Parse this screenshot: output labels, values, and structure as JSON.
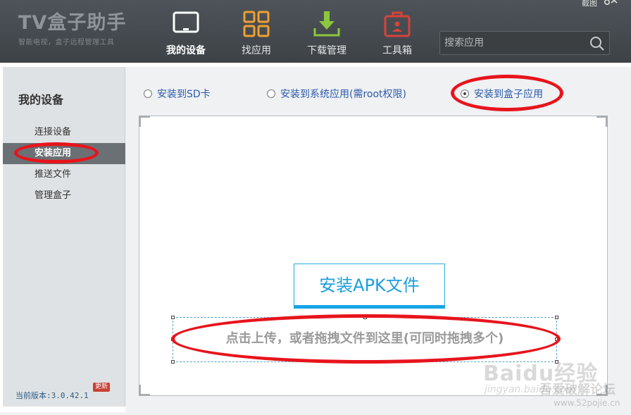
{
  "app": {
    "title": "TV盒子助手",
    "subtitle": "智能电视，盒子远程管理工具"
  },
  "top_bar": {
    "screenshot_label": "截图",
    "settings_icon": "gear-icon",
    "close_icon": "close-icon"
  },
  "nav": [
    {
      "label": "我的设备",
      "icon": "tv-icon",
      "active": true
    },
    {
      "label": "找应用",
      "icon": "grid-icon",
      "active": false
    },
    {
      "label": "下载管理",
      "icon": "download-icon",
      "active": false
    },
    {
      "label": "工具箱",
      "icon": "toolbox-icon",
      "active": false
    }
  ],
  "search": {
    "placeholder": "搜索应用",
    "icon": "search-icon"
  },
  "sidebar": {
    "title": "我的设备",
    "items": [
      {
        "label": "连接设备",
        "active": false
      },
      {
        "label": "安装应用",
        "active": true
      },
      {
        "label": "推送文件",
        "active": false
      },
      {
        "label": "管理盒子",
        "active": false
      }
    ],
    "version": "当前版本:3.0.42.1",
    "update_badge": "更新"
  },
  "install_options": [
    {
      "label": "安装到SD卡",
      "checked": false
    },
    {
      "label": "安装到系统应用(需root权限)",
      "checked": false
    },
    {
      "label": "安装到盒子应用",
      "checked": true
    }
  ],
  "dropzone": {
    "button_label": "安装APK文件",
    "hint": "点击上传，或者拖拽文件到这里(可同时拖拽多个)"
  },
  "watermark": {
    "brand": "Baidu经验",
    "sub": "吾爱破解论坛",
    "jingyan": "jingyan.baidu.com",
    "url": "www.52pojie.cn"
  },
  "colors": {
    "header_bg": "#444a4e",
    "accent_blue": "#1c9fdc",
    "annotation_red": "#e8141c",
    "nav_orange": "#f0a030",
    "nav_green": "#8cc63f",
    "nav_red": "#d9433a"
  }
}
